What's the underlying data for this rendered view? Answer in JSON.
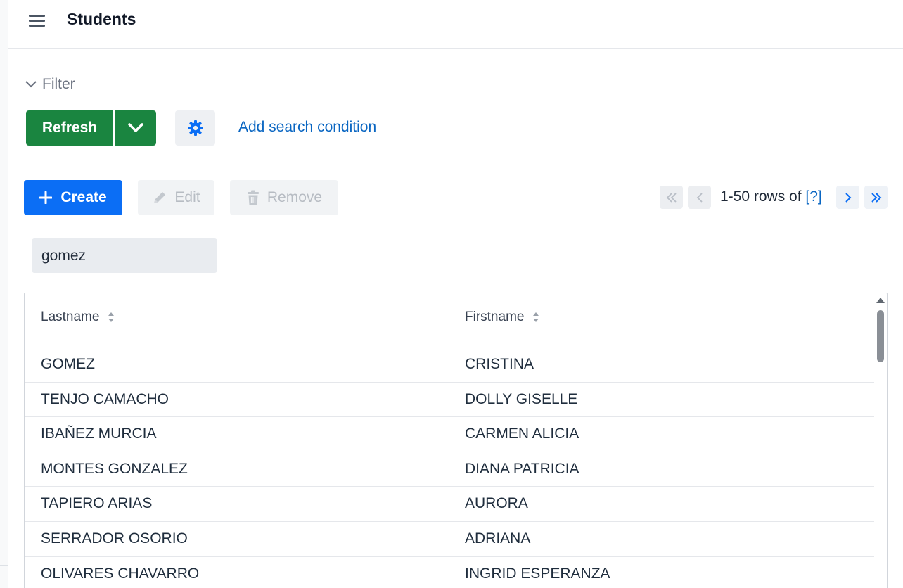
{
  "header": {
    "title": "Students",
    "menu_icon": "hamburger-menu-icon"
  },
  "filter": {
    "toggle_label": "Filter",
    "refresh_label": "Refresh",
    "add_condition_label": "Add search condition"
  },
  "toolbar": {
    "create_label": "Create",
    "edit_label": "Edit",
    "remove_label": "Remove"
  },
  "pager": {
    "range_text": "1-50 rows of",
    "help_text": "[?]"
  },
  "search": {
    "value": "gomez"
  },
  "table": {
    "columns": [
      "Lastname",
      "Firstname"
    ],
    "rows": [
      {
        "lastname": "GOMEZ",
        "firstname": "CRISTINA"
      },
      {
        "lastname": "TENJO CAMACHO",
        "firstname": "DOLLY GISELLE"
      },
      {
        "lastname": "IBAÑEZ MURCIA",
        "firstname": "CARMEN ALICIA"
      },
      {
        "lastname": "MONTES GONZALEZ",
        "firstname": "DIANA PATRICIA"
      },
      {
        "lastname": "TAPIERO ARIAS",
        "firstname": "AURORA"
      },
      {
        "lastname": "SERRADOR OSORIO",
        "firstname": "ADRIANA"
      },
      {
        "lastname": "OLIVARES CHAVARRO",
        "firstname": "INGRID ESPERANZA"
      }
    ]
  },
  "colors": {
    "refresh": "#1a8540",
    "create": "#0b6ef5",
    "link": "#0a66c2"
  }
}
